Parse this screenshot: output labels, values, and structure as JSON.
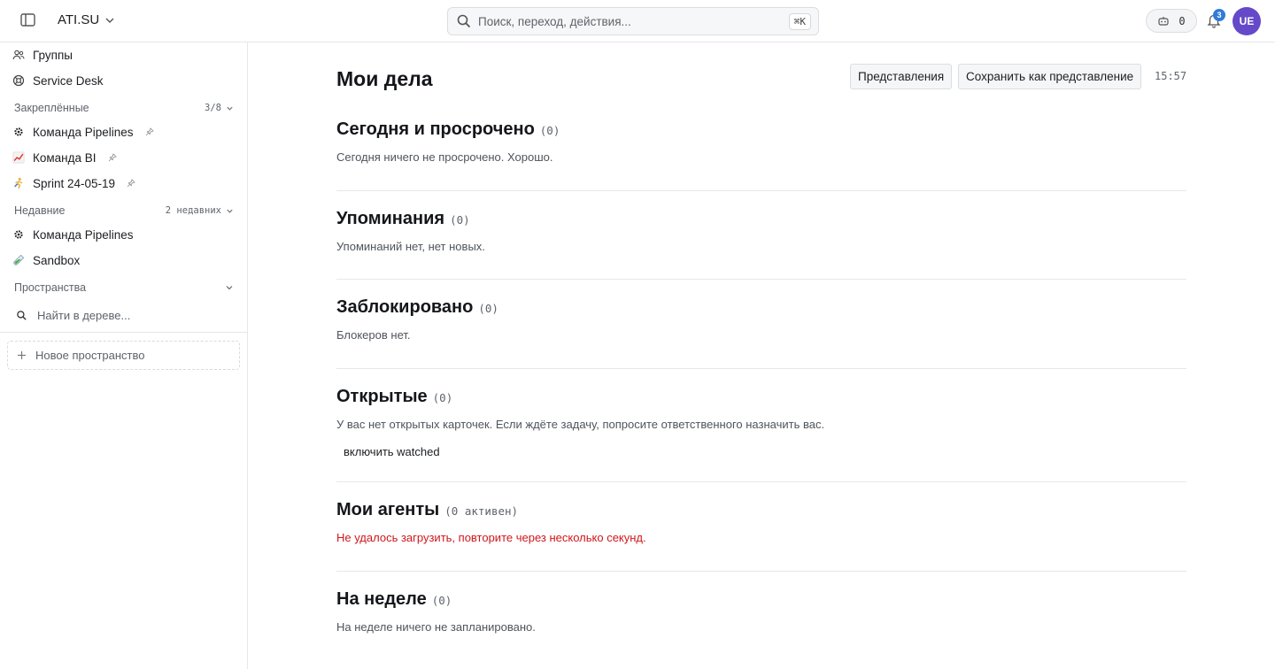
{
  "topbar": {
    "workspace": "ATI.SU",
    "search_placeholder": "Поиск, переход, действия...",
    "search_shortcut": "⌘K",
    "agent_count": "0",
    "notifications_count": "3",
    "avatar_initials": "UE",
    "accent": "#6549c9"
  },
  "sidebar": {
    "top_items": [
      {
        "label": "Группы",
        "icon": "users-icon"
      },
      {
        "label": "Service Desk",
        "icon": "lifebuoy-icon"
      }
    ],
    "pinned": {
      "title": "Закреплённые",
      "meta": "3/8",
      "items": [
        {
          "label": "Команда Pipelines",
          "icon": "gear-emoji"
        },
        {
          "label": "Команда BI",
          "icon": "chart-emoji"
        },
        {
          "label": "Sprint 24-05-19",
          "icon": "runner-emoji"
        }
      ]
    },
    "recent": {
      "title": "Недавние",
      "meta": "2 недавних",
      "items": [
        {
          "label": "Команда Pipelines",
          "icon": "gear-emoji"
        },
        {
          "label": "Sandbox",
          "icon": "test-tube-emoji"
        }
      ]
    },
    "spaces": {
      "title": "Пространства",
      "search_placeholder": "Найти в дереве...",
      "new_space": "Новое пространство"
    }
  },
  "main": {
    "title": "Мои дела",
    "views_button": "Представления",
    "save_view_button": "Сохранить как представление",
    "time": "15:57",
    "sections": [
      {
        "title": "Сегодня и просрочено",
        "count": "(0)",
        "text": "Сегодня ничего не просрочено. Хорошо."
      },
      {
        "title": "Упоминания",
        "count": "(0)",
        "text": "Упоминаний нет, нет новых."
      },
      {
        "title": "Заблокировано",
        "count": "(0)",
        "text": "Блокеров нет."
      },
      {
        "title": "Открытые",
        "count": "(0)",
        "text": "У вас нет открытых карточек. Если ждёте задачу, попросите ответственного назначить вас.",
        "action": "включить watched"
      },
      {
        "title": "Мои агенты",
        "count": "(0 активен)",
        "text": "Не удалось загрузить, повторите через несколько секунд.",
        "error_color": "#d0161b"
      },
      {
        "title": "На неделе",
        "count": "(0)",
        "text": "На неделе ничего не запланировано."
      }
    ]
  }
}
